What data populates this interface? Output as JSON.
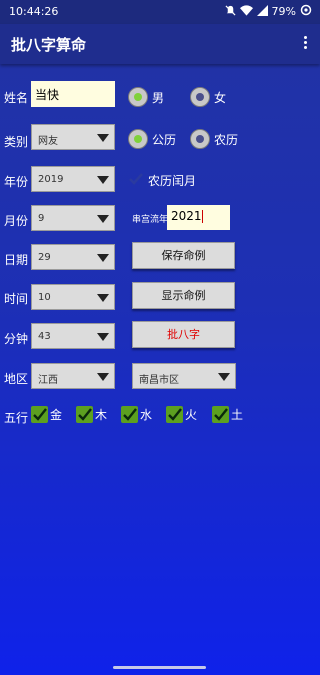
{
  "status": {
    "time": "10:44:26",
    "battery": "79%"
  },
  "app": {
    "title": "批八字算命"
  },
  "labels": {
    "name": "姓名",
    "category": "类别",
    "year": "年份",
    "month": "月份",
    "day": "日期",
    "hour": "时间",
    "minute": "分钟",
    "region": "地区",
    "five_elements": "五行"
  },
  "name_field": {
    "value": "当快"
  },
  "gender": {
    "male": "男",
    "female": "女",
    "selected": "male"
  },
  "category": {
    "value": "网友"
  },
  "calendar": {
    "solar": "公历",
    "lunar": "农历",
    "selected": "solar"
  },
  "year": {
    "value": "2019"
  },
  "leap_month": {
    "label": "农历闰月",
    "checked": false
  },
  "month": {
    "value": "9"
  },
  "palace": {
    "label": "串宫流年",
    "value": "2021"
  },
  "day": {
    "value": "29"
  },
  "hour": {
    "value": "10"
  },
  "minute": {
    "value": "43"
  },
  "buttons": {
    "save": "保存命例",
    "show": "显示命例",
    "calc": "批八字"
  },
  "province": {
    "value": "江西"
  },
  "district": {
    "value": "南昌市区"
  },
  "elements": [
    {
      "label": "金",
      "checked": true
    },
    {
      "label": "木",
      "checked": true
    },
    {
      "label": "水",
      "checked": true
    },
    {
      "label": "火",
      "checked": true
    },
    {
      "label": "土",
      "checked": true
    }
  ],
  "colors": {
    "calc_button_text": "#e00000",
    "radio_selected": "#7fd13a",
    "radio_unselected": "#4a4f8c",
    "check": "#5ca020"
  }
}
